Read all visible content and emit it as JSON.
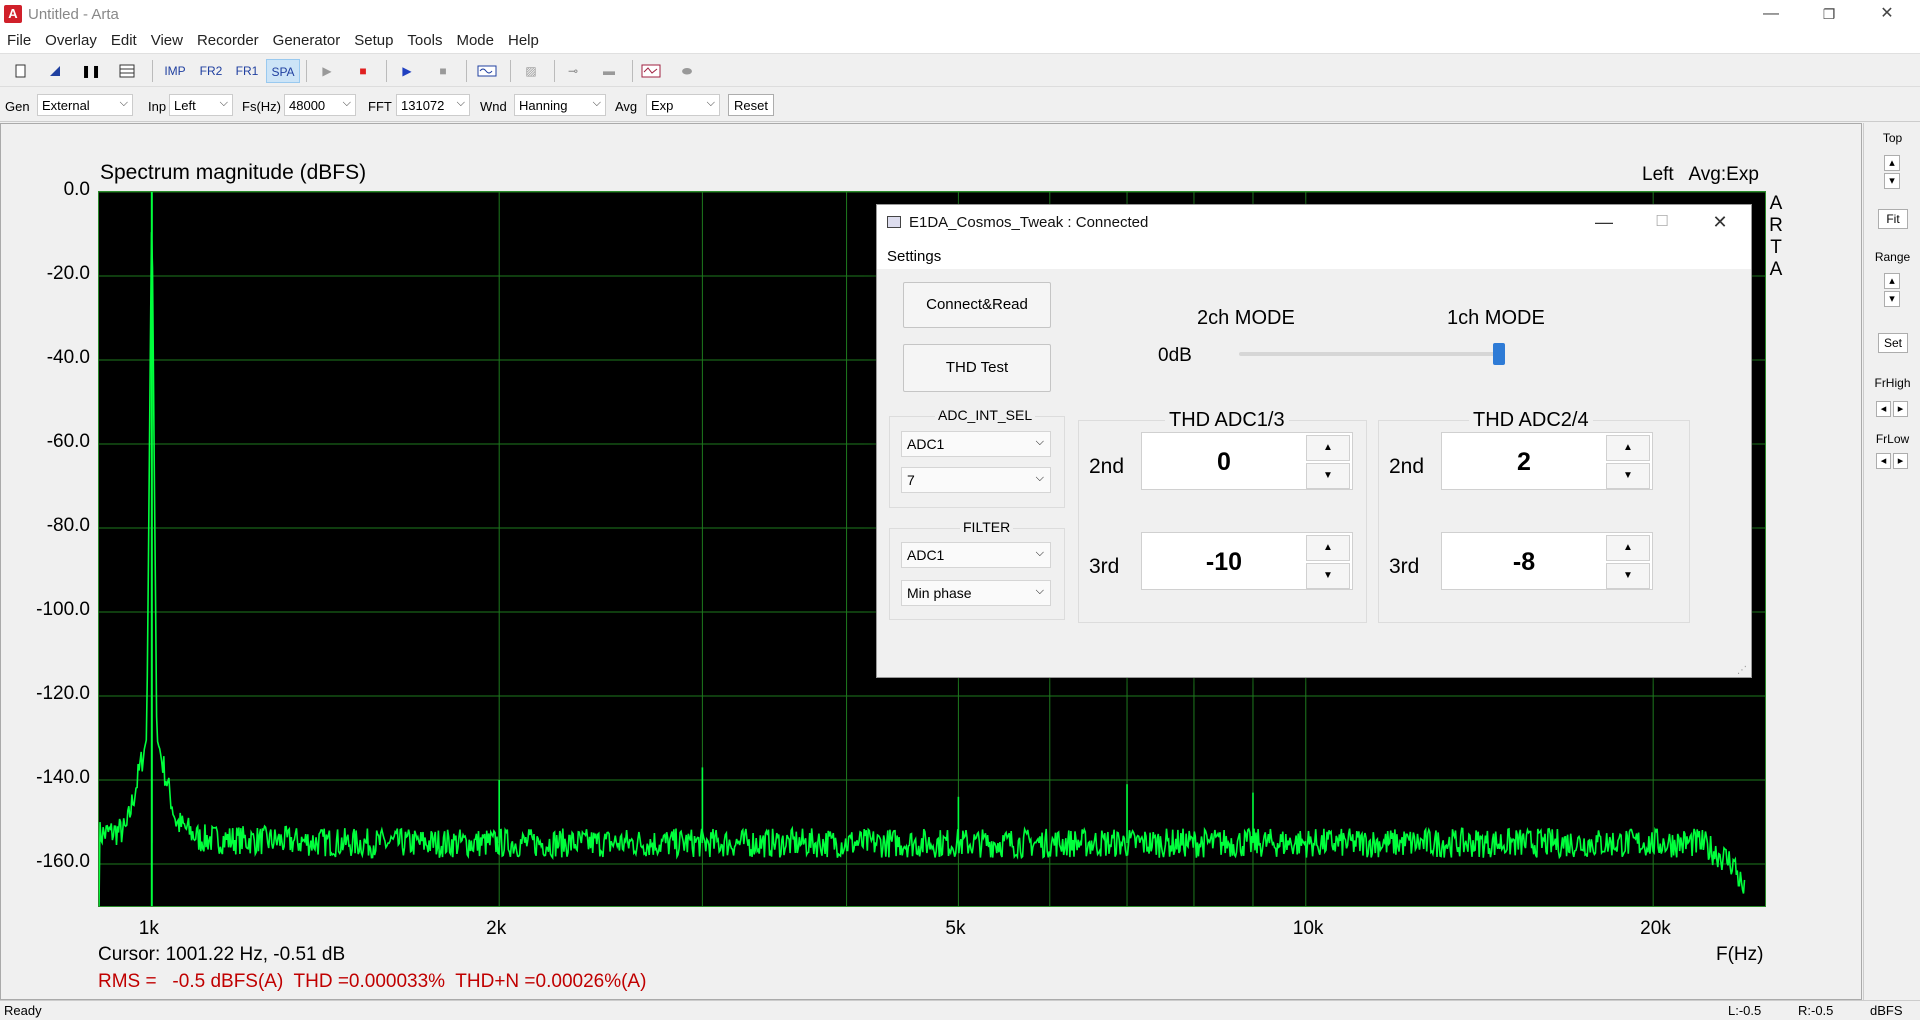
{
  "window": {
    "title": "Untitled - Arta",
    "minimize": "—",
    "restore": "❐",
    "close": "✕"
  },
  "menu": [
    "File",
    "Overlay",
    "Edit",
    "View",
    "Recorder",
    "Generator",
    "Setup",
    "Tools",
    "Mode",
    "Help"
  ],
  "toolbar": {
    "imp": "IMP",
    "fr2": "FR2",
    "fr1": "FR1",
    "spa": "SPA"
  },
  "params": {
    "gen_label": "Gen",
    "gen_value": "External",
    "inp_label": "Inp",
    "inp_value": "Left",
    "fs_label": "Fs(Hz)",
    "fs_value": "48000",
    "fft_label": "FFT",
    "fft_value": "131072",
    "wnd_label": "Wnd",
    "wnd_value": "Hanning",
    "avg_label": "Avg",
    "avg_value": "Exp",
    "reset_label": "Reset"
  },
  "plot": {
    "title": "Spectrum magnitude (dBFS)",
    "top_right": "Left   Avg:Exp",
    "brand": [
      "A",
      "R",
      "T",
      "A"
    ],
    "cursor": "Cursor: 1001.22 Hz, -0.51 dB",
    "x_unit": "F(Hz)",
    "measurement": "RMS =   -0.5 dBFS(A)  THD =0.000033%  THD+N =0.00026%(A)",
    "trace_color": "#00ff3c",
    "grid_color": "#1e7a1e"
  },
  "chart_data": {
    "type": "line",
    "title": "Spectrum magnitude (dBFS)",
    "xlabel": "F(Hz)",
    "ylabel": "",
    "x_scale": "log",
    "xlim": [
      900,
      25000
    ],
    "ylim": [
      -170,
      0
    ],
    "y_ticks": [
      "0.0",
      "-20.0",
      "-40.0",
      "-60.0",
      "-80.0",
      "-100.0",
      "-120.0",
      "-140.0",
      "-160.0"
    ],
    "x_ticks": [
      "1k",
      "2k",
      "5k",
      "10k",
      "20k"
    ],
    "grid": true,
    "noise_floor_db": -155,
    "peaks": [
      {
        "x": 1000,
        "y": -0.5
      },
      {
        "x": 2000,
        "y": -140
      },
      {
        "x": 3000,
        "y": -137
      },
      {
        "x": 5000,
        "y": -144
      },
      {
        "x": 7000,
        "y": -141
      },
      {
        "x": 9000,
        "y": -143
      }
    ],
    "series": [
      {
        "x": [
          900,
          950,
          990,
          1000,
          1010,
          1050,
          1100,
          1500,
          2000,
          3000,
          5000,
          10000,
          15000,
          20000,
          22000,
          23500,
          24000
        ],
        "y": [
          -153,
          -152,
          -130,
          -0.5,
          -130,
          -150,
          -154,
          -155,
          -155,
          -155,
          -155,
          -155,
          -155,
          -155,
          -155,
          -160,
          -167
        ]
      }
    ]
  },
  "right_panel": {
    "top": "Top",
    "fit": "Fit",
    "range": "Range",
    "set": "Set",
    "frhigh": "FrHigh",
    "frlow": "FrLow"
  },
  "status": {
    "left": "Ready",
    "l_value": "L:-0.5",
    "r_value": "R:-0.5",
    "unit": "dBFS"
  },
  "dialog": {
    "title": "E1DA_Cosmos_Tweak : Connected",
    "menu_settings": "Settings",
    "connect_button": "Connect&Read",
    "thd_test_button": "THD Test",
    "adc_int_sel_label": "ADC_INT_SEL",
    "adc_int_sel_value": "ADC1",
    "adc_int_sel_value2": "7",
    "filter_label": "FILTER",
    "filter_adc_value": "ADC1",
    "filter_phase_value": "Min phase",
    "mode_2ch": "2ch MODE",
    "mode_1ch": "1ch MODE",
    "odb_label": "0dB",
    "mode_slider_position": 1.0,
    "thd_adc13_label": "THD ADC1/3",
    "thd_adc24_label": "THD ADC2/4",
    "second_label": "2nd",
    "third_label": "3rd",
    "adc13_2nd": "0",
    "adc13_3rd": "-10",
    "adc24_2nd": "2",
    "adc24_3rd": "-8"
  }
}
